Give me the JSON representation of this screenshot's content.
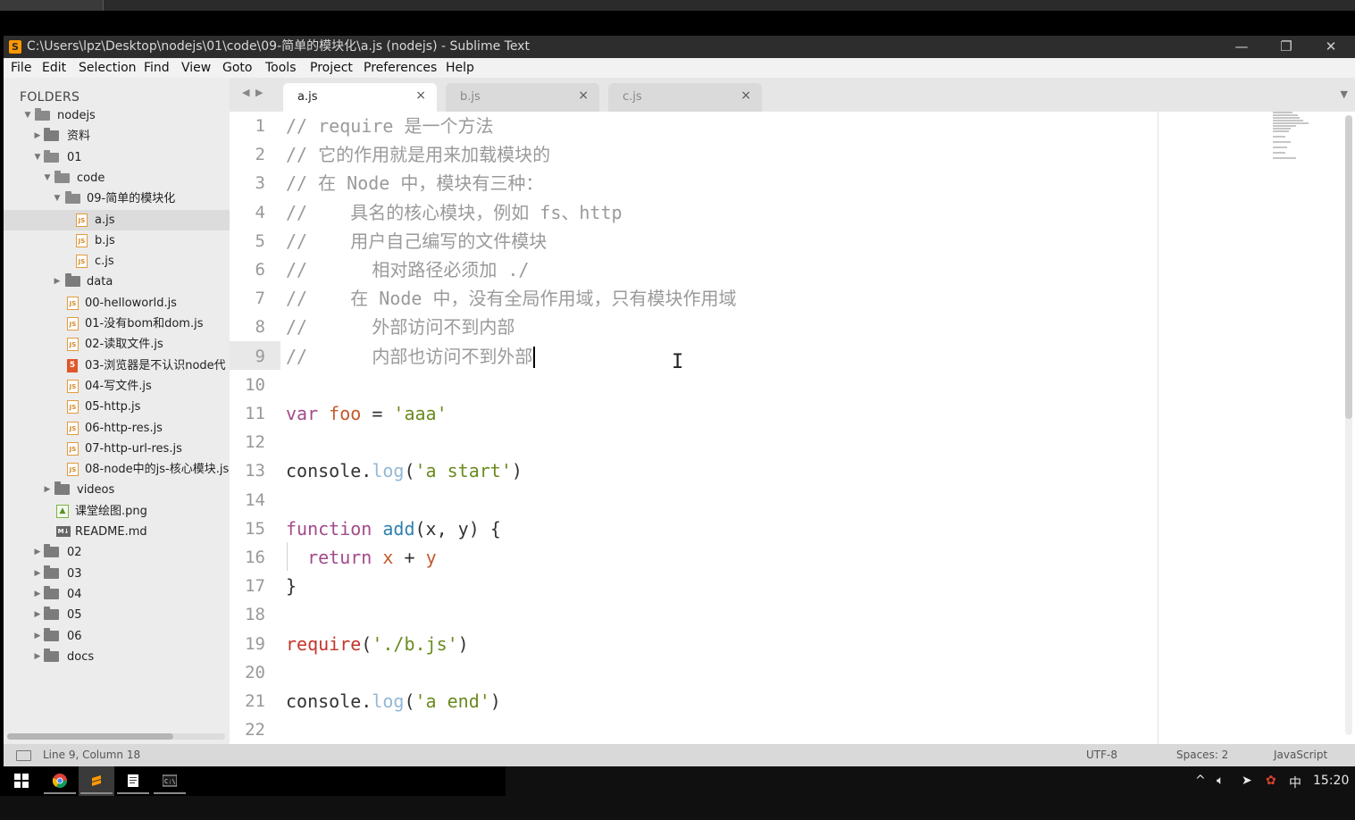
{
  "window": {
    "title": "C:\\Users\\lpz\\Desktop\\nodejs\\01\\code\\09-简单的模块化\\a.js (nodejs) - Sublime Text",
    "minimize": "—",
    "restore": "❐",
    "close": "✕"
  },
  "menu": [
    "File",
    "Edit",
    "Selection",
    "Find",
    "View",
    "Goto",
    "Tools",
    "Project",
    "Preferences",
    "Help"
  ],
  "sidebar": {
    "header": "FOLDERS",
    "items": [
      {
        "label": "nodejs",
        "type": "folder-open",
        "depth": 0
      },
      {
        "label": "资料",
        "type": "folder",
        "depth": 1
      },
      {
        "label": "01",
        "type": "folder-open",
        "depth": 1
      },
      {
        "label": "code",
        "type": "folder-open",
        "depth": 2
      },
      {
        "label": "09-简单的模块化",
        "type": "folder-open",
        "depth": 3
      },
      {
        "label": "a.js",
        "type": "js",
        "depth": 4,
        "selected": true
      },
      {
        "label": "b.js",
        "type": "js",
        "depth": 4
      },
      {
        "label": "c.js",
        "type": "js",
        "depth": 4
      },
      {
        "label": "data",
        "type": "folder",
        "depth": 3
      },
      {
        "label": "00-helloworld.js",
        "type": "js",
        "depth": 3
      },
      {
        "label": "01-没有bom和dom.js",
        "type": "js",
        "depth": 3
      },
      {
        "label": "02-读取文件.js",
        "type": "js",
        "depth": 3
      },
      {
        "label": "03-浏览器是不认识node代",
        "type": "html",
        "depth": 3
      },
      {
        "label": "04-写文件.js",
        "type": "js",
        "depth": 3
      },
      {
        "label": "05-http.js",
        "type": "js",
        "depth": 3
      },
      {
        "label": "06-http-res.js",
        "type": "js",
        "depth": 3
      },
      {
        "label": "07-http-url-res.js",
        "type": "js",
        "depth": 3
      },
      {
        "label": "08-node中的js-核心模块.js",
        "type": "js",
        "depth": 3
      },
      {
        "label": "videos",
        "type": "folder",
        "depth": 2
      },
      {
        "label": "课堂绘图.png",
        "type": "image",
        "depth": 2
      },
      {
        "label": "README.md",
        "type": "md",
        "depth": 2
      },
      {
        "label": "02",
        "type": "folder",
        "depth": 1
      },
      {
        "label": "03",
        "type": "folder",
        "depth": 1
      },
      {
        "label": "04",
        "type": "folder",
        "depth": 1
      },
      {
        "label": "05",
        "type": "folder",
        "depth": 1
      },
      {
        "label": "06",
        "type": "folder",
        "depth": 1
      },
      {
        "label": "docs",
        "type": "folder",
        "depth": 1
      }
    ]
  },
  "tabs": [
    {
      "label": "a.js",
      "active": true
    },
    {
      "label": "b.js",
      "active": false
    },
    {
      "label": "c.js",
      "active": false
    }
  ],
  "editor": {
    "lines": [
      {
        "n": "1",
        "tokens": [
          [
            "c-com",
            "// require 是一个方法"
          ]
        ]
      },
      {
        "n": "2",
        "tokens": [
          [
            "c-com",
            "// 它的作用就是用来加载模块的"
          ]
        ]
      },
      {
        "n": "3",
        "tokens": [
          [
            "c-com",
            "// 在 Node 中，模块有三种："
          ]
        ]
      },
      {
        "n": "4",
        "tokens": [
          [
            "c-com",
            "//    具名的核心模块，例如 fs、http"
          ]
        ]
      },
      {
        "n": "5",
        "tokens": [
          [
            "c-com",
            "//    用户自己编写的文件模块"
          ]
        ]
      },
      {
        "n": "6",
        "tokens": [
          [
            "c-com",
            "//      相对路径必须加 ./"
          ]
        ]
      },
      {
        "n": "7",
        "tokens": [
          [
            "c-com",
            "//    在 Node 中，没有全局作用域，只有模块作用域"
          ]
        ]
      },
      {
        "n": "8",
        "tokens": [
          [
            "c-com",
            "//      外部访问不到内部"
          ]
        ]
      },
      {
        "n": "9",
        "tokens": [
          [
            "c-com",
            "//      内部也访问不到外部"
          ]
        ],
        "caret": true
      },
      {
        "n": "10",
        "tokens": []
      },
      {
        "n": "11",
        "tokens": [
          [
            "c-kw",
            "var"
          ],
          [
            "",
            " "
          ],
          [
            "c-var",
            "foo"
          ],
          [
            "",
            " = "
          ],
          [
            "c-str",
            "'aaa'"
          ]
        ]
      },
      {
        "n": "12",
        "tokens": []
      },
      {
        "n": "13",
        "tokens": [
          [
            "",
            "console."
          ],
          [
            "c-prop",
            "log"
          ],
          [
            "",
            "("
          ],
          [
            "c-str",
            "'a start'"
          ],
          [
            "",
            ")"
          ]
        ]
      },
      {
        "n": "14",
        "tokens": []
      },
      {
        "n": "15",
        "tokens": [
          [
            "c-kw",
            "function"
          ],
          [
            "",
            " "
          ],
          [
            "c-fn",
            "add"
          ],
          [
            "",
            "(x, y) {"
          ]
        ]
      },
      {
        "n": "16",
        "tokens": [
          [
            "",
            "  "
          ],
          [
            "c-kw",
            "return"
          ],
          [
            "",
            " "
          ],
          [
            "c-var",
            "x"
          ],
          [
            "",
            " + "
          ],
          [
            "c-var",
            "y"
          ]
        ]
      },
      {
        "n": "17",
        "tokens": [
          [
            "",
            "}"
          ]
        ]
      },
      {
        "n": "18",
        "tokens": []
      },
      {
        "n": "19",
        "tokens": [
          [
            "c-req",
            "require"
          ],
          [
            "",
            "("
          ],
          [
            "c-str",
            "'./b.js'"
          ],
          [
            "",
            ")"
          ]
        ]
      },
      {
        "n": "20",
        "tokens": []
      },
      {
        "n": "21",
        "tokens": [
          [
            "",
            "console."
          ],
          [
            "c-prop",
            "log"
          ],
          [
            "",
            "("
          ],
          [
            "c-str",
            "'a end'"
          ],
          [
            "",
            ")"
          ]
        ]
      },
      {
        "n": "22",
        "tokens": []
      }
    ]
  },
  "status": {
    "position": "Line 9, Column 18",
    "encoding": "UTF-8",
    "indent": "Spaces: 2",
    "syntax": "JavaScript"
  },
  "taskbar": {
    "apps": [
      "windows-start",
      "chrome",
      "sublime-text",
      "notepad",
      "cmd"
    ],
    "tray_ime": "中",
    "clock": "15:20"
  }
}
